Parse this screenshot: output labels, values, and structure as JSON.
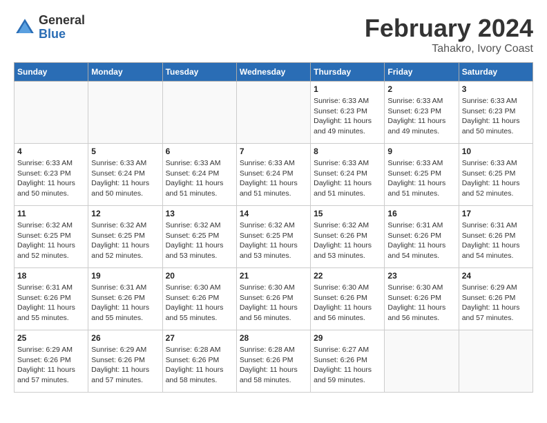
{
  "header": {
    "logo_general": "General",
    "logo_blue": "Blue",
    "title": "February 2024",
    "location": "Tahakro, Ivory Coast"
  },
  "weekdays": [
    "Sunday",
    "Monday",
    "Tuesday",
    "Wednesday",
    "Thursday",
    "Friday",
    "Saturday"
  ],
  "weeks": [
    [
      {
        "day": "",
        "info": ""
      },
      {
        "day": "",
        "info": ""
      },
      {
        "day": "",
        "info": ""
      },
      {
        "day": "",
        "info": ""
      },
      {
        "day": "1",
        "info": "Sunrise: 6:33 AM\nSunset: 6:23 PM\nDaylight: 11 hours\nand 49 minutes."
      },
      {
        "day": "2",
        "info": "Sunrise: 6:33 AM\nSunset: 6:23 PM\nDaylight: 11 hours\nand 49 minutes."
      },
      {
        "day": "3",
        "info": "Sunrise: 6:33 AM\nSunset: 6:23 PM\nDaylight: 11 hours\nand 50 minutes."
      }
    ],
    [
      {
        "day": "4",
        "info": "Sunrise: 6:33 AM\nSunset: 6:23 PM\nDaylight: 11 hours\nand 50 minutes."
      },
      {
        "day": "5",
        "info": "Sunrise: 6:33 AM\nSunset: 6:24 PM\nDaylight: 11 hours\nand 50 minutes."
      },
      {
        "day": "6",
        "info": "Sunrise: 6:33 AM\nSunset: 6:24 PM\nDaylight: 11 hours\nand 51 minutes."
      },
      {
        "day": "7",
        "info": "Sunrise: 6:33 AM\nSunset: 6:24 PM\nDaylight: 11 hours\nand 51 minutes."
      },
      {
        "day": "8",
        "info": "Sunrise: 6:33 AM\nSunset: 6:24 PM\nDaylight: 11 hours\nand 51 minutes."
      },
      {
        "day": "9",
        "info": "Sunrise: 6:33 AM\nSunset: 6:25 PM\nDaylight: 11 hours\nand 51 minutes."
      },
      {
        "day": "10",
        "info": "Sunrise: 6:33 AM\nSunset: 6:25 PM\nDaylight: 11 hours\nand 52 minutes."
      }
    ],
    [
      {
        "day": "11",
        "info": "Sunrise: 6:32 AM\nSunset: 6:25 PM\nDaylight: 11 hours\nand 52 minutes."
      },
      {
        "day": "12",
        "info": "Sunrise: 6:32 AM\nSunset: 6:25 PM\nDaylight: 11 hours\nand 52 minutes."
      },
      {
        "day": "13",
        "info": "Sunrise: 6:32 AM\nSunset: 6:25 PM\nDaylight: 11 hours\nand 53 minutes."
      },
      {
        "day": "14",
        "info": "Sunrise: 6:32 AM\nSunset: 6:25 PM\nDaylight: 11 hours\nand 53 minutes."
      },
      {
        "day": "15",
        "info": "Sunrise: 6:32 AM\nSunset: 6:26 PM\nDaylight: 11 hours\nand 53 minutes."
      },
      {
        "day": "16",
        "info": "Sunrise: 6:31 AM\nSunset: 6:26 PM\nDaylight: 11 hours\nand 54 minutes."
      },
      {
        "day": "17",
        "info": "Sunrise: 6:31 AM\nSunset: 6:26 PM\nDaylight: 11 hours\nand 54 minutes."
      }
    ],
    [
      {
        "day": "18",
        "info": "Sunrise: 6:31 AM\nSunset: 6:26 PM\nDaylight: 11 hours\nand 55 minutes."
      },
      {
        "day": "19",
        "info": "Sunrise: 6:31 AM\nSunset: 6:26 PM\nDaylight: 11 hours\nand 55 minutes."
      },
      {
        "day": "20",
        "info": "Sunrise: 6:30 AM\nSunset: 6:26 PM\nDaylight: 11 hours\nand 55 minutes."
      },
      {
        "day": "21",
        "info": "Sunrise: 6:30 AM\nSunset: 6:26 PM\nDaylight: 11 hours\nand 56 minutes."
      },
      {
        "day": "22",
        "info": "Sunrise: 6:30 AM\nSunset: 6:26 PM\nDaylight: 11 hours\nand 56 minutes."
      },
      {
        "day": "23",
        "info": "Sunrise: 6:30 AM\nSunset: 6:26 PM\nDaylight: 11 hours\nand 56 minutes."
      },
      {
        "day": "24",
        "info": "Sunrise: 6:29 AM\nSunset: 6:26 PM\nDaylight: 11 hours\nand 57 minutes."
      }
    ],
    [
      {
        "day": "25",
        "info": "Sunrise: 6:29 AM\nSunset: 6:26 PM\nDaylight: 11 hours\nand 57 minutes."
      },
      {
        "day": "26",
        "info": "Sunrise: 6:29 AM\nSunset: 6:26 PM\nDaylight: 11 hours\nand 57 minutes."
      },
      {
        "day": "27",
        "info": "Sunrise: 6:28 AM\nSunset: 6:26 PM\nDaylight: 11 hours\nand 58 minutes."
      },
      {
        "day": "28",
        "info": "Sunrise: 6:28 AM\nSunset: 6:26 PM\nDaylight: 11 hours\nand 58 minutes."
      },
      {
        "day": "29",
        "info": "Sunrise: 6:27 AM\nSunset: 6:26 PM\nDaylight: 11 hours\nand 59 minutes."
      },
      {
        "day": "",
        "info": ""
      },
      {
        "day": "",
        "info": ""
      }
    ]
  ]
}
